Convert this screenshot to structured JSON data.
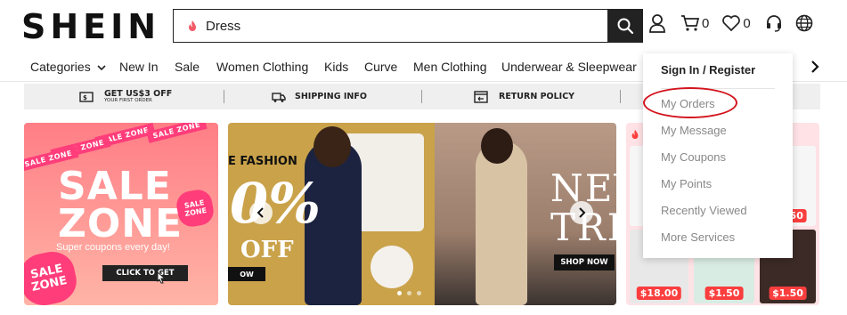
{
  "header": {
    "logo": "SHEIN",
    "search_value": "Dress",
    "cart_count": "0",
    "wishlist_count": "0"
  },
  "nav": {
    "items": [
      "Categories",
      "New In",
      "Sale",
      "Women Clothing",
      "Kids",
      "Curve",
      "Men Clothing",
      "Underwear & Sleepwear"
    ]
  },
  "infobar": {
    "coupon": "GET US$3 OFF",
    "coupon_sub": "YOUR FIRST ORDER",
    "shipping": "SHIPPING INFO",
    "returns": "RETURN POLICY"
  },
  "banners": {
    "sale_ribbon": "SALE ZONE",
    "sale_line1": "SALE",
    "sale_line2": "ZONE",
    "sale_sub": "Super coupons every day!",
    "sale_cta": "CLICK TO GET",
    "carousel_left_text": "E FASHION",
    "carousel_big": "0%",
    "carousel_off": "OFF",
    "carousel_shop_left": "OW",
    "carousel_new_line1": "NEV",
    "carousel_new_line2": "TRE",
    "carousel_shop_right": "SHOP NOW",
    "grid_prices": [
      "$18.00",
      "$1.50",
      "$1.50"
    ],
    "grid_price_top": "$1.50"
  },
  "account_menu": {
    "header": "Sign In / Register",
    "items": [
      "My Orders",
      "My Message",
      "My Coupons",
      "My Points",
      "Recently Viewed",
      "More Services"
    ]
  },
  "colors": {
    "accent_red": "#d3141d",
    "price_red": "#fa3e3e",
    "sale_pink": "#ff7e86"
  }
}
